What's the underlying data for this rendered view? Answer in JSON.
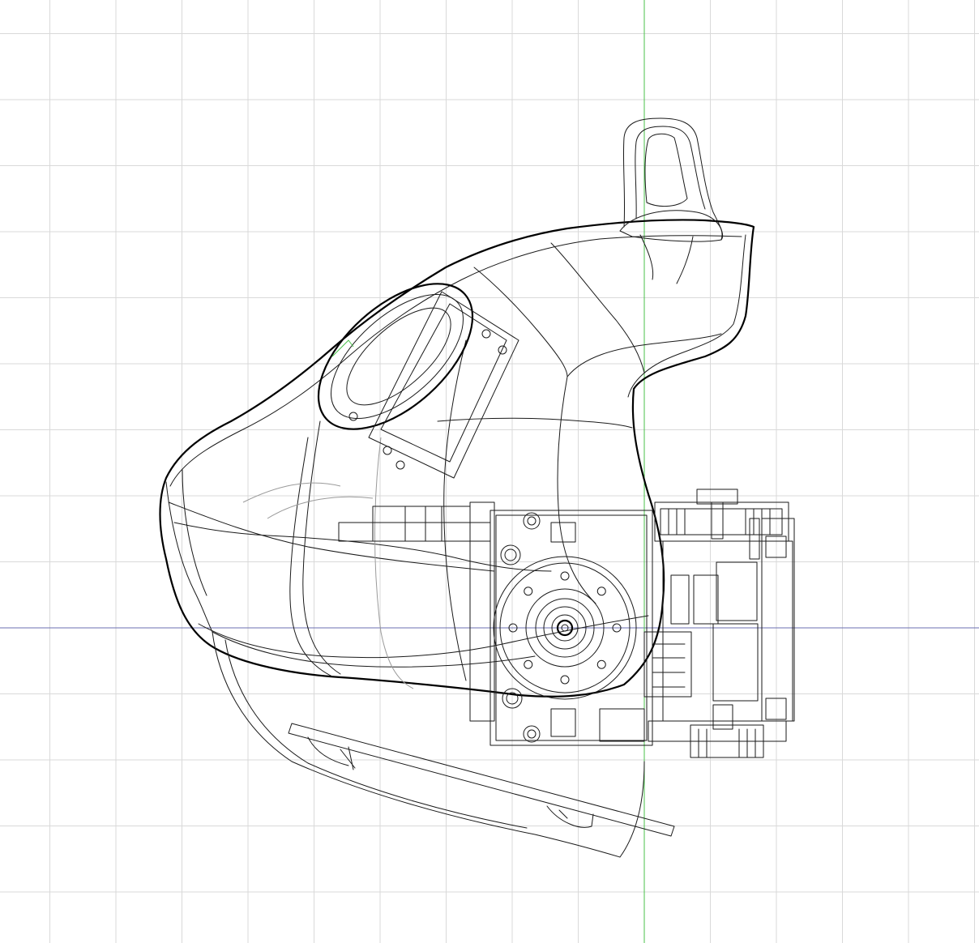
{
  "viewport": {
    "label": "",
    "colors": {
      "background": "#ffffff",
      "grid": "#d9d9d9",
      "wireframe": "#1a1a1a",
      "x_axis": "#6b6fb0",
      "y_axis": "#49c24a"
    }
  },
  "model": {
    "view": "side",
    "render_style": "wireframe",
    "parts": [
      "handle-housing",
      "top-trigger",
      "side-thumb-button",
      "motor-gearbox-module",
      "servo-horn",
      "mounting-bracket",
      "base-plate"
    ]
  }
}
